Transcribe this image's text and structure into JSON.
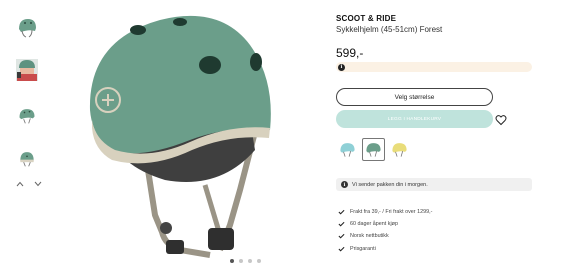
{
  "thumbnails": [
    {
      "name": "helmet-front-view"
    },
    {
      "name": "child-wearing-helmet"
    },
    {
      "name": "helmet-side-view"
    },
    {
      "name": "helmet-back-view"
    }
  ],
  "carousel": {
    "total_dots": 4,
    "active_index": 0
  },
  "product": {
    "brand": "SCOOT & RIDE",
    "name": "Sykkelhjelm (45-51cm) Forest",
    "price": "599,-",
    "colors": {
      "helmet": "#6b9e8a",
      "helmet_dark": "#4f7b6a",
      "cart_button": "#bfe3dc",
      "info_bar": "#fbf1e4"
    }
  },
  "actions": {
    "size_label": "Velg størrelse",
    "cart_label": "LEGG I HANDLEKURV"
  },
  "swatches": [
    {
      "name": "blue",
      "color": "#8fd0d6",
      "selected": false
    },
    {
      "name": "forest",
      "color": "#6b9e8a",
      "selected": true
    },
    {
      "name": "yellow",
      "color": "#e9dd7a",
      "selected": false
    }
  ],
  "shipping": {
    "text": "Vi sender pakken din i morgen."
  },
  "usps": [
    "Frakt fra 39,- / Fri frakt over 1299,-",
    "60 dager åpent kjøp",
    "Norsk nettbutikk",
    "Prisgaranti"
  ]
}
